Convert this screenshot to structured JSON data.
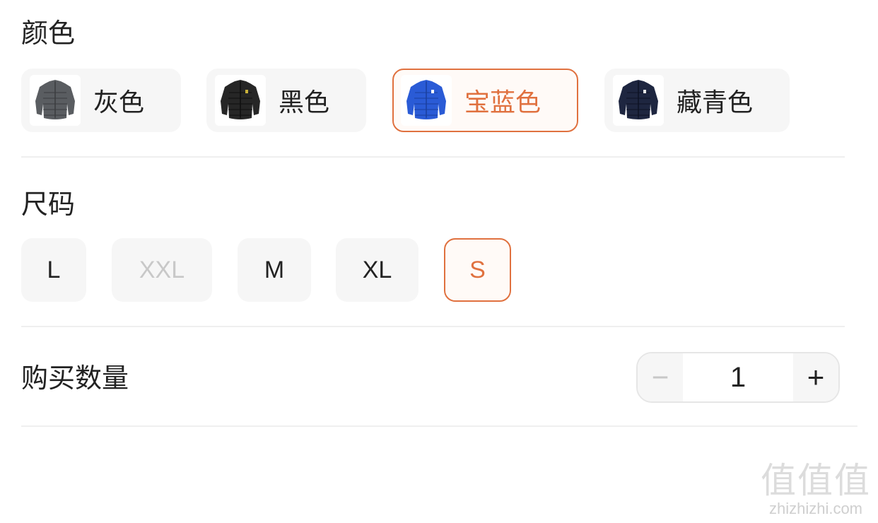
{
  "color_section": {
    "title": "颜色",
    "options": [
      {
        "label": "灰色",
        "jacket_color": "#5a5d61",
        "selected": false
      },
      {
        "label": "黑色",
        "jacket_color": "#262626",
        "selected": false
      },
      {
        "label": "宝蓝色",
        "jacket_color": "#2a5bd6",
        "selected": true
      },
      {
        "label": "藏青色",
        "jacket_color": "#1e2640",
        "selected": false
      }
    ]
  },
  "size_section": {
    "title": "尺码",
    "options": [
      {
        "label": "L",
        "state": "normal"
      },
      {
        "label": "XXL",
        "state": "disabled"
      },
      {
        "label": "M",
        "state": "normal"
      },
      {
        "label": "XL",
        "state": "normal"
      },
      {
        "label": "S",
        "state": "selected"
      }
    ]
  },
  "quantity_section": {
    "title": "购买数量",
    "minus_symbol": "−",
    "value": "1",
    "plus_symbol": "+"
  },
  "watermark": {
    "glyphs": "值值值",
    "site": "zhizhizhi.com"
  },
  "colors": {
    "accent": "#e0713f",
    "chip_background": "#f6f6f6",
    "disabled_text": "#c8c8c8"
  }
}
